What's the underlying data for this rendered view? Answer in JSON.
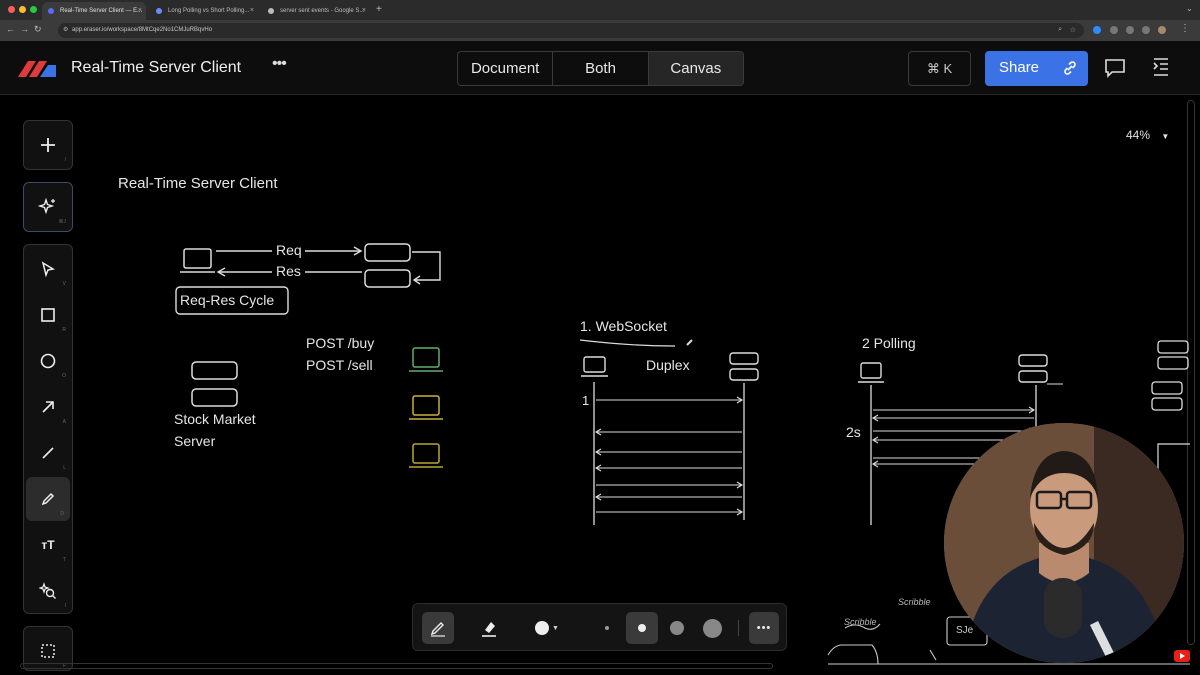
{
  "browser": {
    "tabs": [
      {
        "label": "Real-Time Server Client — E...",
        "active": true,
        "favicon_color": "#5b6bff"
      },
      {
        "label": "Long Polling vs Short Polling...",
        "active": false,
        "favicon_color": "#6a8cff"
      },
      {
        "label": "server sent events - Google S...",
        "active": false,
        "favicon_color": "#bbbbbb"
      }
    ],
    "new_tab": "+",
    "url": "app.eraser.io/workspace/8MtCqe2No1CMJuRBqvHo"
  },
  "header": {
    "title": "Real-Time Server Client",
    "more": "•••",
    "modes": [
      "Document",
      "Both",
      "Canvas"
    ],
    "active_mode": "Canvas",
    "command": "⌘ K",
    "share_label": "Share"
  },
  "toolbar": {
    "add_key": "/",
    "ai_key": "⌘J",
    "tools": [
      {
        "name": "select",
        "key": "V"
      },
      {
        "name": "rectangle",
        "key": "R"
      },
      {
        "name": "circle",
        "key": "O"
      },
      {
        "name": "arrow",
        "key": "A"
      },
      {
        "name": "line",
        "key": "L"
      },
      {
        "name": "pen",
        "key": "D"
      },
      {
        "name": "text",
        "key": "T"
      },
      {
        "name": "icon",
        "key": "I"
      },
      {
        "name": "frame",
        "key": "F"
      }
    ]
  },
  "canvas": {
    "zoom": "44%",
    "heading": "Real-Time Server Client",
    "req_label": "Req",
    "res_label": "Res",
    "req_res_cycle": "Req-Res Cycle",
    "post_buy": "POST /buy",
    "post_sell": "POST /sell",
    "stock_line1": "Stock Market",
    "stock_line2": "Server",
    "websocket": "1. WebSocket",
    "duplex": "Duplex",
    "one": "1",
    "polling": "2 Polling",
    "two_s": "2s",
    "scribble1": "Scribble",
    "scribble2": "Scribble",
    "sje": "SJe"
  },
  "colors": {
    "share": "#3b73e6",
    "client_green": "#5fae6f",
    "client_yellow": "#c6b33a",
    "client_olive": "#b5a833"
  }
}
